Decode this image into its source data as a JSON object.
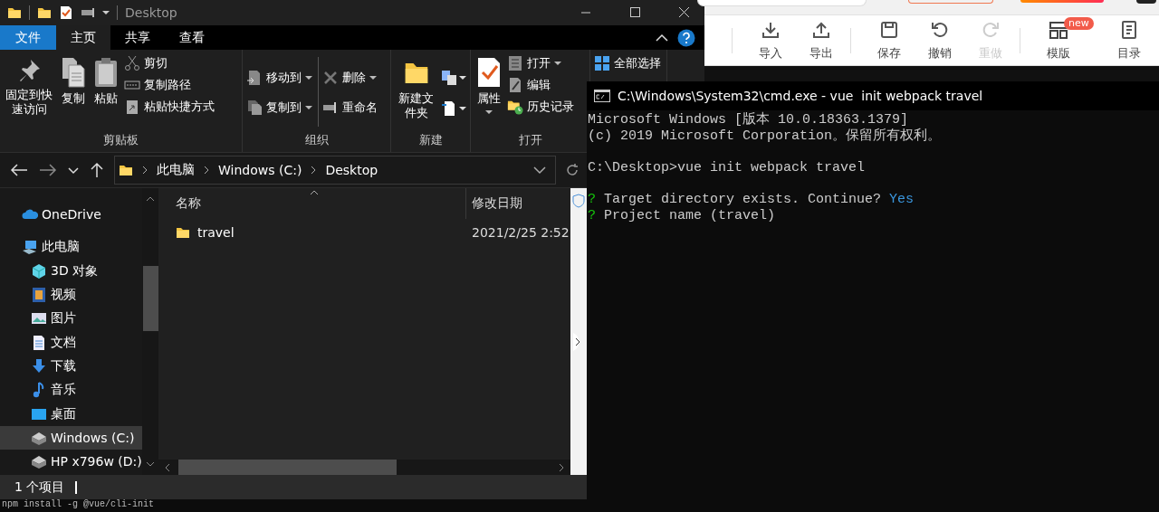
{
  "explorer": {
    "title": "Desktop",
    "ribbon_tabs": [
      {
        "label": "文件",
        "kind": "file",
        "selected": false
      },
      {
        "label": "主页",
        "kind": "tab",
        "selected": true
      },
      {
        "label": "共享",
        "kind": "tab",
        "selected": false
      },
      {
        "label": "查看",
        "kind": "tab",
        "selected": false
      }
    ],
    "ribbon_groups": [
      {
        "label": "剪贴板",
        "columns": [
          [
            {
              "label": "固定到快速访问",
              "kind": "large"
            }
          ],
          [
            {
              "label": "复制",
              "kind": "large"
            }
          ],
          [
            {
              "label": "粘贴",
              "kind": "large"
            }
          ],
          [
            {
              "label": "剪切",
              "kind": "small"
            },
            {
              "label": "复制路径",
              "kind": "small"
            },
            {
              "label": "粘贴快捷方式",
              "kind": "small"
            }
          ]
        ]
      },
      {
        "label": "组织",
        "columns": [
          [
            {
              "label": "移动到",
              "kind": "small",
              "dropdown": true
            },
            {
              "label": "复制到",
              "kind": "small",
              "dropdown": true
            }
          ],
          [
            {
              "label": "删除",
              "kind": "small",
              "dropdown": true
            },
            {
              "label": "重命名",
              "kind": "small"
            }
          ]
        ]
      },
      {
        "label": "新建",
        "columns": [
          [
            {
              "label": "新建文件夹",
              "kind": "large"
            }
          ],
          [
            {
              "kind": "icon",
              "dropdown": true
            },
            {
              "kind": "icon",
              "dropdown": true
            }
          ]
        ]
      },
      {
        "label": "打开",
        "columns": [
          [
            {
              "label": "属性",
              "kind": "large",
              "dropdown": true
            }
          ],
          [
            {
              "label": "打开",
              "kind": "small",
              "dropdown": true
            },
            {
              "label": "编辑",
              "kind": "small"
            },
            {
              "label": "历史记录",
              "kind": "small"
            }
          ]
        ]
      },
      {
        "columns": [
          [
            {
              "label": "全部选择",
              "kind": "small"
            }
          ]
        ]
      }
    ],
    "address": [
      "此电脑",
      "Windows (C:)",
      "Desktop"
    ],
    "nav_items": [
      {
        "label": "OneDrive",
        "kind": "cloud",
        "selected": false
      },
      {
        "label": "此电脑",
        "kind": "computer",
        "selected": false,
        "children": [
          {
            "label": "3D 对象",
            "kind": "cube",
            "selected": false
          },
          {
            "label": "视频",
            "kind": "video",
            "selected": false
          },
          {
            "label": "图片",
            "kind": "picture",
            "selected": false
          },
          {
            "label": "文档",
            "kind": "document",
            "selected": false
          },
          {
            "label": "下载",
            "kind": "download",
            "selected": false
          },
          {
            "label": "音乐",
            "kind": "music",
            "selected": false
          },
          {
            "label": "桌面",
            "kind": "desktop",
            "selected": false
          },
          {
            "label": "Windows (C:)",
            "kind": "drive",
            "selected": true
          },
          {
            "label": "HP x796w (D:)",
            "kind": "drive",
            "selected": false
          }
        ]
      }
    ],
    "columns": [
      "名称",
      "修改日期"
    ],
    "rows": [
      {
        "name": "travel",
        "modified": "2021/2/25 2:52"
      }
    ],
    "status": "1 个项目"
  },
  "toolbar": {
    "groups": [
      {
        "items": [
          {
            "label": "导入",
            "disabled": false
          },
          {
            "label": "导出",
            "disabled": false
          }
        ]
      },
      {
        "items": [
          {
            "label": "保存",
            "disabled": false
          },
          {
            "label": "撤销",
            "disabled": false
          },
          {
            "label": "重做",
            "disabled": true
          }
        ]
      },
      {
        "items": [
          {
            "label": "模版",
            "disabled": false,
            "badge": "new"
          },
          {
            "label": "目录",
            "disabled": false
          }
        ]
      }
    ]
  },
  "cmd": {
    "title": "C:\\Windows\\System32\\cmd.exe - vue  init webpack travel",
    "lines": [
      {
        "kind": "text",
        "segments": [
          {
            "text": "Microsoft Windows [版本 10.0.18363.1379]"
          }
        ]
      },
      {
        "kind": "text",
        "segments": [
          {
            "text": "(c) 2019 Microsoft Corporation。保留所有权利。"
          }
        ]
      },
      {
        "kind": "blank"
      },
      {
        "kind": "text",
        "segments": [
          {
            "text": "C:\\Desktop>vue init webpack travel"
          }
        ]
      },
      {
        "kind": "blank"
      },
      {
        "kind": "text",
        "segments": [
          {
            "text": "?",
            "color": "#16c60c"
          },
          {
            "text": " Target directory exists. Continue? "
          },
          {
            "text": "Yes",
            "color": "#3a96dd"
          }
        ]
      },
      {
        "kind": "text",
        "segments": [
          {
            "text": "?",
            "color": "#16c60c"
          },
          {
            "text": " Project name (travel)"
          }
        ]
      }
    ]
  },
  "back_terminal": {
    "lines": [
      "npm install -g @vue/cli-init"
    ]
  }
}
